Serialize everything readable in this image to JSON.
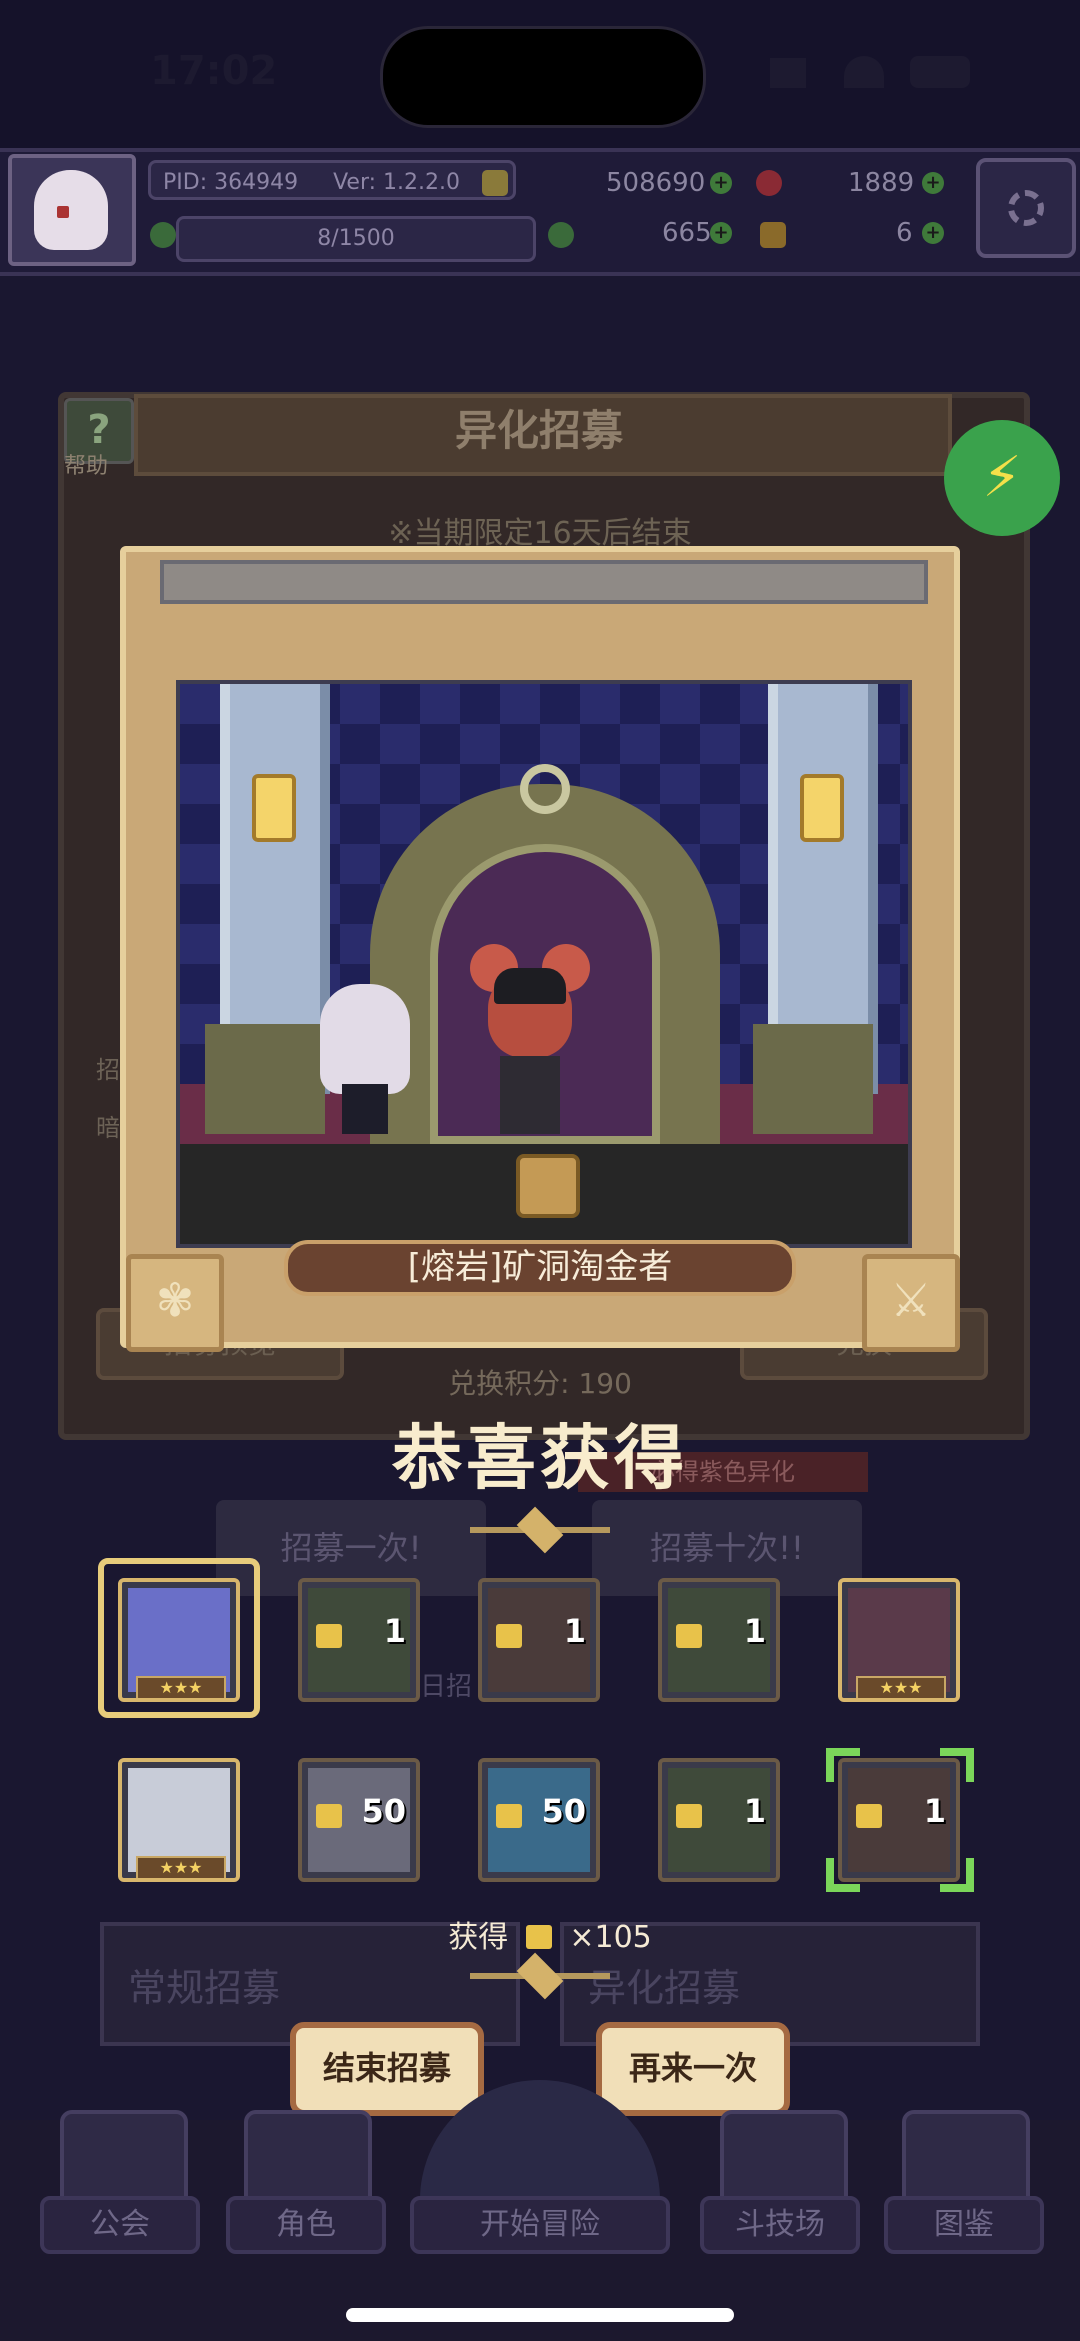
{
  "status_bar": {
    "time": "17:02",
    "signal": "",
    "battery": ""
  },
  "hud": {
    "pid": "PID: 364949",
    "version": "Ver: 1.2.2.0",
    "gold": "508690",
    "gems": "1889",
    "stamina": "8/1500",
    "clover": "665",
    "keys": "6",
    "plus": "+"
  },
  "background_panel": {
    "title": "异化招募",
    "help_label": "帮助",
    "limited_note": "※当期限定16天后结束",
    "side_label_1": "招",
    "side_label_2": "暗",
    "preview_button": "招募预览",
    "exchange_button": "兑换",
    "exchange_points": "兑换积分: 190",
    "guarantee_badge": "必得紫色异化",
    "recruit_once": "招募一次!",
    "recruit_ten": "招募十次!!",
    "progress": "日招 0/99",
    "tab_normal": "常规招募",
    "tab_alien": "异化招募"
  },
  "lightning": {
    "icon": "lightning-icon",
    "glyph": "⚡",
    "color": "#3aa24c"
  },
  "reveal": {
    "character_name": "[熔岩]矿洞淘金者",
    "left_corner_icon": "paw-icon",
    "right_corner_icon": "sword-icon",
    "left_glyph": "✾",
    "right_glyph": "⚔"
  },
  "result": {
    "title": "恭喜获得",
    "obtained_prefix": "获得",
    "obtained_amount": "×105",
    "stars": "★★★",
    "cards": [
      {
        "type": "character",
        "rarity": "gold",
        "stars": 3,
        "palette": "#6a6fc8"
      },
      {
        "type": "shard",
        "count": "1",
        "palette": "#3f4a3a"
      },
      {
        "type": "shard",
        "count": "1",
        "palette": "#4a3b3a"
      },
      {
        "type": "shard",
        "count": "1",
        "palette": "#3f4a3a"
      },
      {
        "type": "character",
        "rarity": "gold",
        "stars": 3,
        "palette": "#5a3a4a"
      },
      {
        "type": "character",
        "rarity": "gold",
        "stars": 3,
        "palette": "#c8ccd8"
      },
      {
        "type": "shard",
        "count": "50",
        "palette": "#6a6a7a"
      },
      {
        "type": "shard",
        "count": "50",
        "palette": "#3a6a8a"
      },
      {
        "type": "shard",
        "count": "1",
        "palette": "#3f4a3a"
      },
      {
        "type": "shard",
        "count": "1",
        "palette": "#4a3b3a"
      }
    ],
    "end_button": "结束招募",
    "again_button": "再来一次"
  },
  "nav": {
    "guild": "公会",
    "characters": "角色",
    "adventure": "开始冒险",
    "arena": "斗技场",
    "codex": "图鉴"
  }
}
